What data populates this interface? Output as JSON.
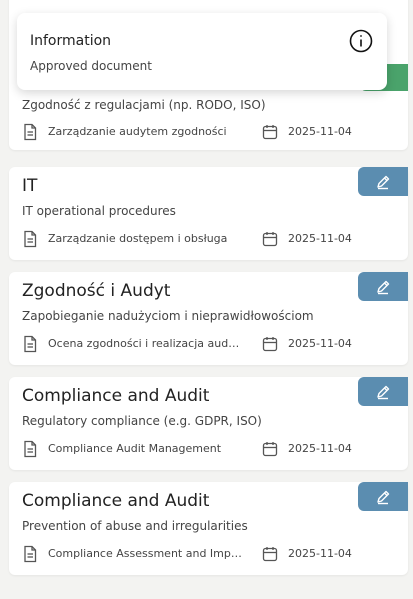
{
  "toast": {
    "title": "Information",
    "message": "Approved document"
  },
  "cards": [
    {
      "title": "",
      "subtitle": "Zgodność z regulacjami (np. RODO, ISO)",
      "meta": "Zarządzanie audytem zgodności",
      "date": "2025-11-04",
      "status_color": "#4aa36b"
    },
    {
      "title": "IT",
      "subtitle": "IT operational procedures",
      "meta": "Zarządzanie dostępem i obsługa",
      "date": "2025-11-04"
    },
    {
      "title": "Zgodność i Audyt",
      "subtitle": "Zapobieganie nadużyciom i nieprawidłowościom",
      "meta": "Ocena zgodności i realizacja audytów",
      "date": "2025-11-04"
    },
    {
      "title": "Compliance and Audit",
      "subtitle": "Regulatory compliance (e.g. GDPR, ISO)",
      "meta": "Compliance Audit Management",
      "date": "2025-11-04"
    },
    {
      "title": "Compliance and Audit",
      "subtitle": "Prevention of abuse and irregularities",
      "meta": "Compliance Assessment and Implementation",
      "date": "2025-11-04"
    }
  ],
  "colors": {
    "edit_button": "#5b8db0",
    "approved_tab": "#4aa36b"
  },
  "icons": {
    "edit": "pencil-icon",
    "document": "document-icon",
    "calendar": "calendar-icon",
    "info": "info-icon"
  }
}
